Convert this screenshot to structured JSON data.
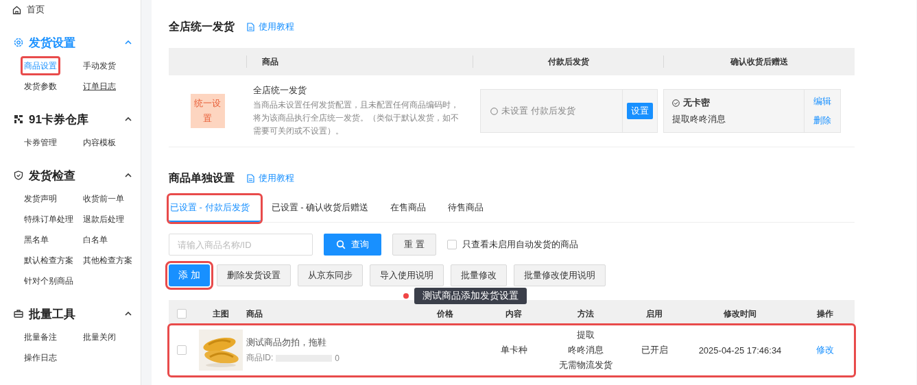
{
  "sidebar": {
    "home": {
      "label": "首页"
    },
    "groups": [
      {
        "title": "发货设置",
        "active": true,
        "expanded": true,
        "items": [
          {
            "label": "商品设置",
            "selected": true,
            "highlighted": true,
            "underlined": false
          },
          {
            "label": "手动发货",
            "selected": false,
            "highlighted": false,
            "underlined": false
          },
          {
            "label": "发货参数",
            "selected": false,
            "highlighted": false,
            "underlined": false
          },
          {
            "label": "订单日志",
            "selected": false,
            "highlighted": false,
            "underlined": true
          }
        ]
      },
      {
        "title": "91卡券仓库",
        "active": false,
        "expanded": true,
        "items": [
          {
            "label": "卡券管理",
            "selected": false,
            "highlighted": false,
            "underlined": false
          },
          {
            "label": "内容模板",
            "selected": false,
            "highlighted": false,
            "underlined": false
          }
        ]
      },
      {
        "title": "发货检查",
        "active": false,
        "expanded": true,
        "items": [
          {
            "label": "发货声明",
            "selected": false,
            "highlighted": false,
            "underlined": false
          },
          {
            "label": "收货前一单",
            "selected": false,
            "highlighted": false,
            "underlined": false
          },
          {
            "label": "特殊订单处理",
            "selected": false,
            "highlighted": false,
            "underlined": false
          },
          {
            "label": "退款后处理",
            "selected": false,
            "highlighted": false,
            "underlined": false
          },
          {
            "label": "黑名单",
            "selected": false,
            "highlighted": false,
            "underlined": false
          },
          {
            "label": "白名单",
            "selected": false,
            "highlighted": false,
            "underlined": false
          },
          {
            "label": "默认检查方案",
            "selected": false,
            "highlighted": false,
            "underlined": false
          },
          {
            "label": "其他检查方案",
            "selected": false,
            "highlighted": false,
            "underlined": false
          },
          {
            "label": "针对个别商品",
            "selected": false,
            "highlighted": false,
            "underlined": false
          }
        ]
      },
      {
        "title": "批量工具",
        "active": false,
        "expanded": true,
        "items": [
          {
            "label": "批量备注",
            "selected": false,
            "highlighted": false,
            "underlined": false
          },
          {
            "label": "批量关闭",
            "selected": false,
            "highlighted": false,
            "underlined": false
          },
          {
            "label": "操作日志",
            "selected": false,
            "highlighted": false,
            "underlined": false
          }
        ]
      }
    ]
  },
  "store_section": {
    "title": "全店统一发货",
    "tutorial_link": "使用教程",
    "columns": [
      "商品",
      "付款后发货",
      "确认收货后赠送"
    ],
    "row": {
      "badge": "统一设置",
      "name": "全店统一发货",
      "description": "当商品未设置任何发货配置，且未配置任何商品编码时，将为该商品执行全店统一发货。（类似于默认发货，如不需要可关闭或不设置）。",
      "after_payment": {
        "status": "未设置 付款后发货",
        "button": "设置"
      },
      "after_receipt": {
        "title": "无卡密",
        "detail": "提取咚咚消息",
        "actions": [
          "编辑",
          "删除"
        ]
      }
    }
  },
  "item_section": {
    "title": "商品单独设置",
    "tutorial_link": "使用教程",
    "tabs": [
      {
        "label": "已设置 - 付款后发货",
        "selected": true,
        "highlighted": true
      },
      {
        "label": "已设置 - 确认收货后赠送",
        "selected": false,
        "highlighted": false
      },
      {
        "label": "在售商品",
        "selected": false,
        "highlighted": false
      },
      {
        "label": "待售商品",
        "selected": false,
        "highlighted": false
      }
    ],
    "search": {
      "placeholder": "请输入商品名称/ID",
      "query_button": "查询",
      "reset_button": "重 置",
      "filter_label": "只查看未启用自动发货的商品",
      "filter_checked": false
    },
    "actions": [
      {
        "label": "添 加",
        "kind": "primary",
        "highlighted": true
      },
      {
        "label": "删除发货设置",
        "kind": "default"
      },
      {
        "label": "从京东同步",
        "kind": "default"
      },
      {
        "label": "导入使用说明",
        "kind": "default"
      },
      {
        "label": "批量修改",
        "kind": "default"
      },
      {
        "label": "批量修改使用说明",
        "kind": "default"
      }
    ],
    "tooltip": "测试商品添加发货设置",
    "table": {
      "all_checked": false,
      "columns": [
        "主图",
        "商品",
        "价格",
        "内容",
        "方法",
        "启用",
        "修改时间",
        "操作"
      ],
      "rows": [
        {
          "checked": false,
          "highlighted": true,
          "image": {
            "kind": "picture"
          },
          "name": "测试商品勿拍，拖鞋",
          "id_label": "商品ID:",
          "id_redacted": true,
          "id_tail": "0",
          "content": "单卡种",
          "method": [
            "提取",
            "咚咚消息",
            "无需物流发货"
          ],
          "enabled": "已开启",
          "modified": "2025-04-25 17:46:34",
          "action": "修改"
        }
      ]
    }
  }
}
